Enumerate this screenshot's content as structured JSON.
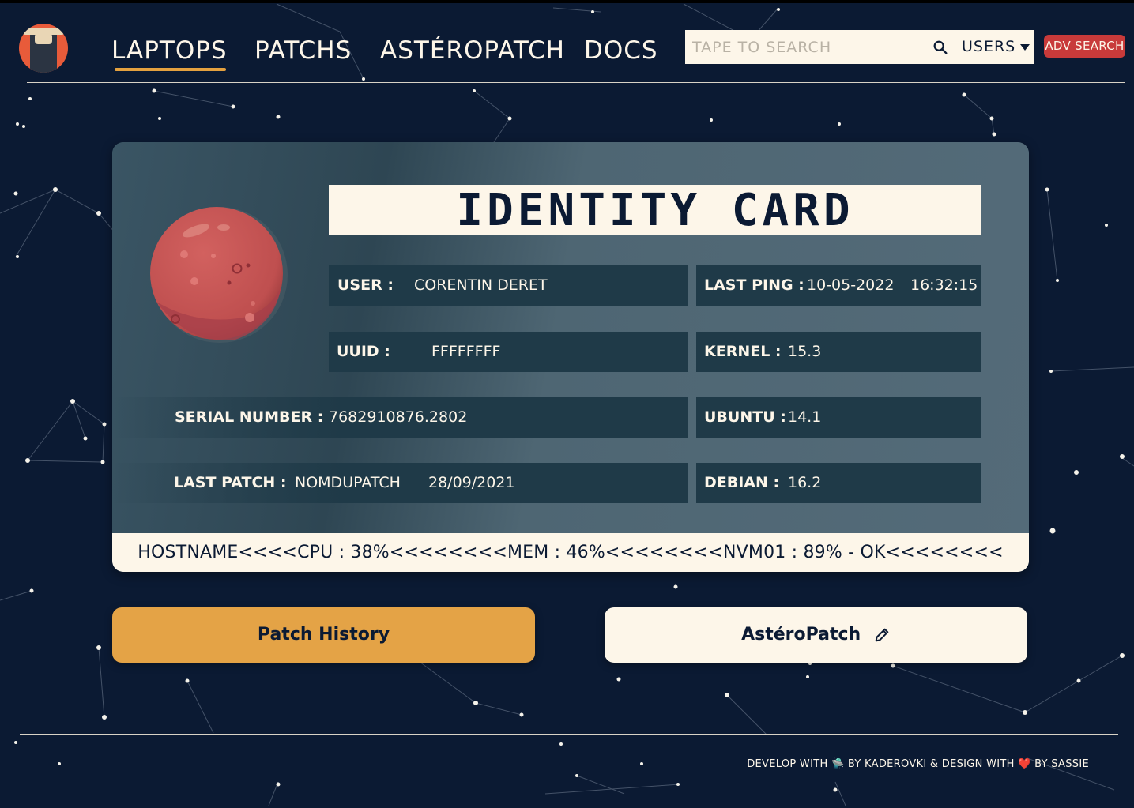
{
  "nav": {
    "links": [
      "LAPTOPS",
      "PATCHS",
      "ASTÉROPATCH",
      "DOCS"
    ],
    "active": "LAPTOPS"
  },
  "search": {
    "placeholder": "TAPE TO SEARCH",
    "scope": "USERS",
    "adv_label": "ADV SEARCH"
  },
  "card": {
    "title": "IDENTITY CARD",
    "user_label": "USER :",
    "user_value": "CORENTIN DERET",
    "last_ping_label": "LAST PING :",
    "last_ping_date": "10-05-2022",
    "last_ping_time": "16:32:15",
    "uuid_label": "UUID :",
    "uuid_value": "FFFFFFFF",
    "kernel_label": "KERNEL :",
    "kernel_value": "15.3",
    "serial_label": "SERIAL NUMBER :",
    "serial_value": "7682910876.2802",
    "ubuntu_label": "UBUNTU :",
    "ubuntu_value": "14.1",
    "last_patch_label": "LAST PATCH :",
    "last_patch_name": "NOMDUPATCH",
    "last_patch_date": "28/09/2021",
    "debian_label": "DEBIAN :",
    "debian_value": "16.2",
    "strip": "HOSTNAME<<<<CPU : 38%<<<<<<<<MEM : 46%<<<<<<<<NVM01 : 89% - OK<<<<<<<<"
  },
  "buttons": {
    "history": "Patch History",
    "asteropatch": "AstéroPatch"
  },
  "footer": {
    "part1": "DEVELOP WITH 🛸 BY  KADEROVKI & DESIGN WITH ",
    "heart": "❤️",
    "part2": " BY SASSIE"
  },
  "colors": {
    "background": "#0b1a33",
    "accent": "#e4a346",
    "danger": "#c83a3a",
    "cream": "#fdf6e9",
    "field": "#1f3a48"
  }
}
